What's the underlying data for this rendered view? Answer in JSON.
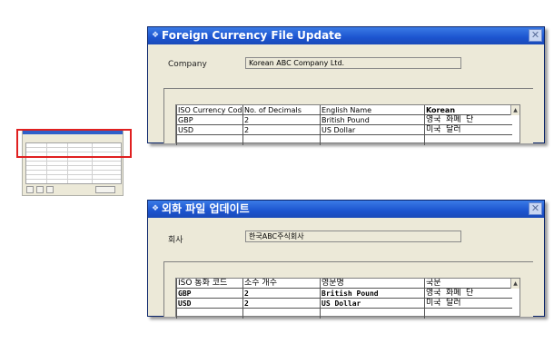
{
  "windows": {
    "english": {
      "title": "Foreign Currency File Update",
      "company_label": "Company",
      "company_value": "Korean ABC Company Ltd.",
      "columns": [
        "ISO Currency Code",
        "No. of Decimals",
        "English Name",
        "Korean"
      ],
      "rows": [
        [
          "GBP",
          "2",
          "British Pound",
          "영국 화폐 단"
        ],
        [
          "USD",
          "2",
          "US Dollar",
          "미국 달러"
        ]
      ]
    },
    "korean": {
      "title": "외화 파일 업데이트",
      "company_label": "회사",
      "company_value": "한국ABC주식회사",
      "columns": [
        "ISO 통화 코드",
        "소수 개수",
        "영문명",
        "국문"
      ],
      "rows": [
        [
          "GBP",
          "2",
          "British Pound",
          "영국 화폐 단"
        ],
        [
          "USD",
          "2",
          "US Dollar",
          "미국 달러"
        ]
      ]
    }
  },
  "icons": {
    "close": "close-icon",
    "app": "app-icon",
    "scroll_up": "scroll-up-arrow-icon"
  },
  "colors": {
    "titlebar": "#1c54cf",
    "highlight": "#e02020",
    "window_bg": "#ece9d8"
  }
}
